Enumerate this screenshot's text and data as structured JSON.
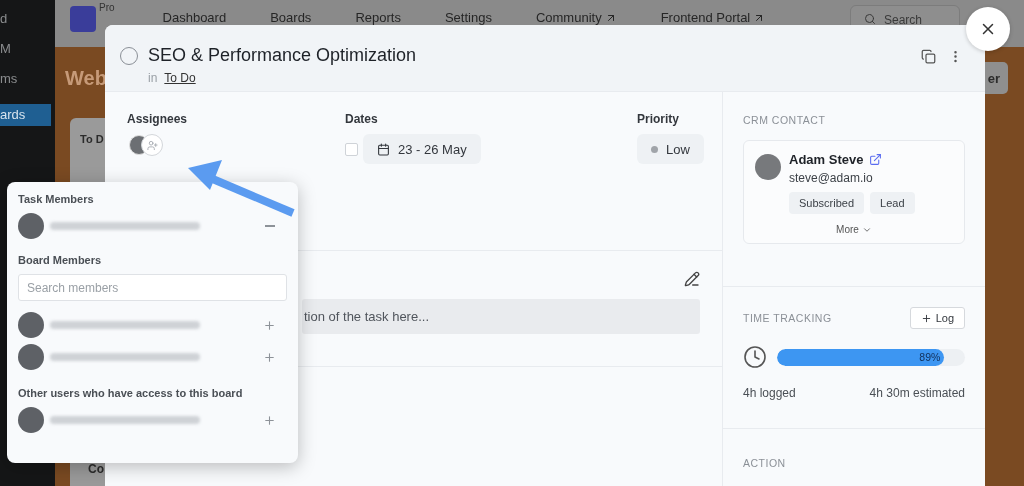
{
  "background": {
    "sidebar_items": [
      {
        "label": "d",
        "selected": false
      },
      {
        "label": "M",
        "selected": false
      },
      {
        "label": "ms",
        "selected": false
      },
      {
        "label": "ards",
        "selected": true
      }
    ],
    "logo_badge": "Pro",
    "nav": [
      {
        "label": "Dashboard",
        "external": false
      },
      {
        "label": "Boards",
        "external": false
      },
      {
        "label": "Reports",
        "external": false
      },
      {
        "label": "Settings",
        "external": false
      },
      {
        "label": "Community",
        "external": true
      },
      {
        "label": "Frontend Portal",
        "external": true
      }
    ],
    "search": {
      "placeholder": "Search"
    },
    "board_title": "Web",
    "column_title": "To D",
    "header_button": "er",
    "footer_text": "Co"
  },
  "task": {
    "title": "SEO & Performance Optimization",
    "completed": false,
    "list_prefix": "in",
    "list": "To Do",
    "assignees": {
      "label": "Assignees"
    },
    "dates": {
      "label": "Dates",
      "done": false,
      "range": "23 - 26 May"
    },
    "priority": {
      "label": "Priority",
      "value": "Low"
    },
    "description": {
      "placeholder": "tion of the task here..."
    }
  },
  "crm_contact": {
    "heading": "CRM CONTACT",
    "name": "Adam Steve",
    "email": "steve@adam.io",
    "tags": [
      "Subscribed",
      "Lead"
    ],
    "more": "More"
  },
  "time_tracking": {
    "heading": "TIME TRACKING",
    "log_button": "Log",
    "level": 0.89,
    "percent": "89%",
    "logged": "4h logged",
    "estimated": "4h 30m estimated"
  },
  "action": {
    "heading": "ACTION"
  },
  "member_popover": {
    "task_members": {
      "title": "Task Members",
      "members": [
        {
          "kind": "remove"
        }
      ]
    },
    "board_members": {
      "title": "Board Members",
      "search": {
        "placeholder": "Search members"
      },
      "members": [
        {
          "kind": "add"
        },
        {
          "kind": "add"
        }
      ]
    },
    "other_users": {
      "title": "Other users who have access to this board",
      "members": [
        {
          "kind": "add"
        }
      ]
    }
  }
}
